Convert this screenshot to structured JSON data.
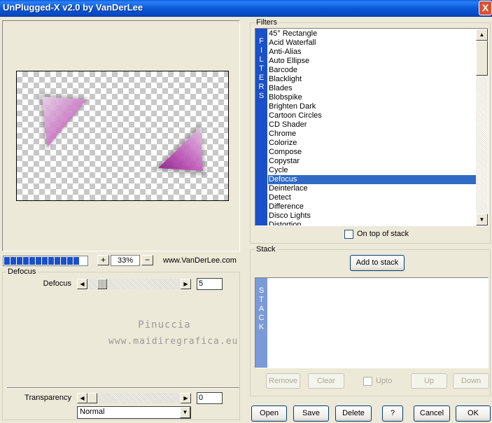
{
  "window": {
    "title": "UnPlugged-X v2.0 by VanDerLee",
    "close_symbol": "X"
  },
  "preview": {
    "zoom_plus": "+",
    "zoom_minus": "−",
    "zoom_value": "33%",
    "url": "www.VanDerLee.com"
  },
  "params": {
    "group_title": "Defocus",
    "defocus_label": "Defocus",
    "defocus_value": "5",
    "watermark_line1": "Pinuccia",
    "watermark_line2": "www.maidiregrafica.eu",
    "transparency_label": "Transparency",
    "transparency_value": "0",
    "blend_mode": "Normal"
  },
  "filters": {
    "group_title": "Filters",
    "strip_letters": [
      "F",
      "I",
      "L",
      "T",
      "E",
      "R",
      "S"
    ],
    "items": [
      "45° Rectangle",
      "Acid Waterfall",
      "Anti-Alias",
      "Auto Ellipse",
      "Barcode",
      "Blacklight",
      "Blades",
      "Blobspike",
      "Brighten Dark",
      "Cartoon Circles",
      "CD Shader",
      "Chrome",
      "Colorize",
      "Compose",
      "Copystar",
      "Cycle",
      "Defocus",
      "Deinterlace",
      "Detect",
      "Difference",
      "Disco Lights",
      "Distortion"
    ],
    "selected": "Defocus",
    "on_top_label": "On top of stack"
  },
  "stack": {
    "group_title": "Stack",
    "add_label": "Add to stack",
    "strip_letters": [
      "S",
      "T",
      "A",
      "C",
      "K"
    ],
    "remove_label": "Remove",
    "clear_label": "Clear",
    "upto_label": "Upto",
    "up_label": "Up",
    "down_label": "Down"
  },
  "buttons": {
    "open": "Open",
    "save": "Save",
    "delete": "Delete",
    "help": "?",
    "cancel": "Cancel",
    "ok": "OK"
  },
  "colors": {
    "accent": "#1A50C8",
    "selection": "#316AC5",
    "shape": "#C040B0"
  }
}
